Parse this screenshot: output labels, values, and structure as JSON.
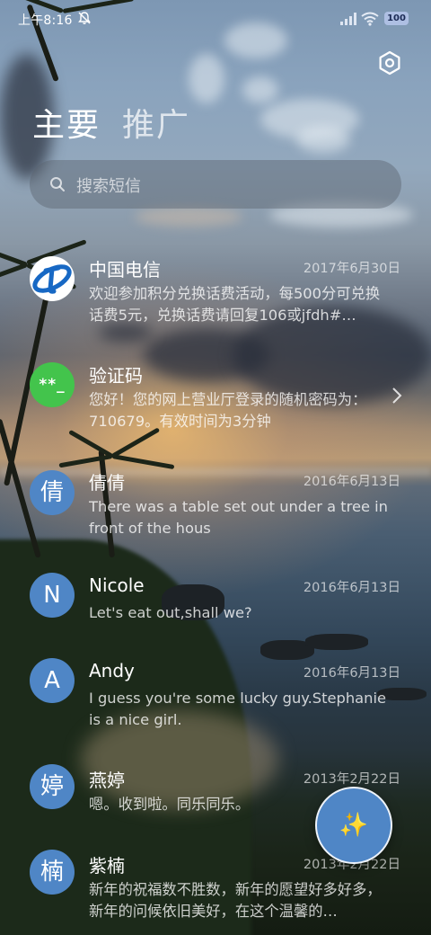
{
  "status_bar": {
    "time": "上午8:16",
    "battery": "100"
  },
  "tabs": [
    {
      "label": "主要"
    },
    {
      "label": "推广"
    }
  ],
  "search": {
    "placeholder": "搜索短信"
  },
  "messages": [
    {
      "name": "中国电信",
      "date": "2017年6月30日",
      "avatar": "",
      "avatar_type": "china-telecom-logo",
      "preview": "欢迎参加积分兑换话费活动，每500分可兑换话费5元，兑换话费请回复106或jfdh#…"
    },
    {
      "name": "验证码",
      "date": "",
      "avatar": "**_",
      "avatar_type": "verification",
      "preview": "您好！您的网上营业厅登录的随机密码为：710679。有效时间为3分钟"
    },
    {
      "name": "倩倩",
      "date": "2016年6月13日",
      "avatar": "倩",
      "avatar_type": "letter",
      "preview": "There was a table set out under a tree in front of the hous"
    },
    {
      "name": "Nicole",
      "date": "2016年6月13日",
      "avatar": "N",
      "avatar_type": "letter",
      "preview": "Let's eat out,shall we?"
    },
    {
      "name": "Andy",
      "date": "2016年6月13日",
      "avatar": "A",
      "avatar_type": "letter",
      "preview": "I guess you're some lucky guy.Stephanie is a nice girl."
    },
    {
      "name": "燕婷",
      "date": "2013年2月22日",
      "avatar": "婷",
      "avatar_type": "letter",
      "preview": "嗯。收到啦。同乐同乐。"
    },
    {
      "name": "紫楠",
      "date": "2013年2月22日",
      "avatar": "楠",
      "avatar_type": "letter",
      "preview": "新年的祝福数不胜数，新年的愿望好多好多，新年的问候依旧美好，在这个温馨的…"
    }
  ],
  "fab": {
    "icon": "sparkle-icon"
  },
  "colors": {
    "avatar_blue": "#4f86c6",
    "avatar_green": "#43c44c"
  }
}
